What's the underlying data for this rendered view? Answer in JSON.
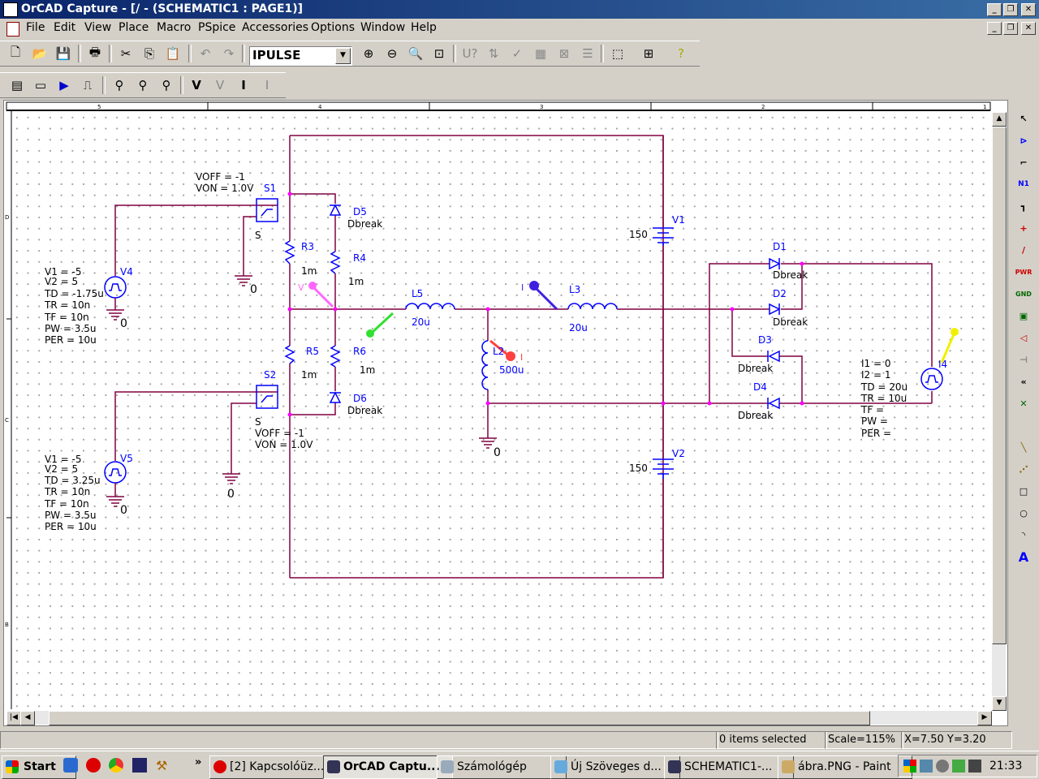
{
  "window": {
    "title": "OrCAD Capture - [/ - (SCHEMATIC1 : PAGE1)]"
  },
  "menu": [
    "File",
    "Edit",
    "View",
    "Place",
    "Macro",
    "PSpice",
    "Accessories",
    "Options",
    "Window",
    "Help"
  ],
  "toolbar": {
    "part_combo_value": "IPULSE"
  },
  "ruler": {
    "columns": [
      "5",
      "4",
      "3",
      "2",
      "1"
    ],
    "rows": [
      "D",
      "C",
      "B"
    ]
  },
  "schematic": {
    "switches": [
      {
        "ref": "S1",
        "label": "S",
        "voff": "VOFF = -1",
        "von": "VON = 1.0V"
      },
      {
        "ref": "S2",
        "label": "S",
        "voff": "VOFF = -1",
        "von": "VON = 1.0V"
      }
    ],
    "diodes": [
      {
        "ref": "D5",
        "model": "Dbreak"
      },
      {
        "ref": "D6",
        "model": "Dbreak"
      },
      {
        "ref": "D1",
        "model": "Dbreak"
      },
      {
        "ref": "D2",
        "model": "Dbreak"
      },
      {
        "ref": "D3",
        "model": "Dbreak"
      },
      {
        "ref": "D4",
        "model": "Dbreak"
      }
    ],
    "resistors": [
      {
        "ref": "R3",
        "value": "1m"
      },
      {
        "ref": "R4",
        "value": "1m"
      },
      {
        "ref": "R5",
        "value": "1m"
      },
      {
        "ref": "R6",
        "value": "1m"
      }
    ],
    "inductors": [
      {
        "ref": "L5",
        "value": "20u"
      },
      {
        "ref": "L3",
        "value": "20u"
      },
      {
        "ref": "L2",
        "value": "500u"
      }
    ],
    "batteries": [
      {
        "ref": "V1",
        "value": "150"
      },
      {
        "ref": "V2",
        "value": "150"
      }
    ],
    "ground_label": "0",
    "v4": {
      "ref": "V4",
      "params": [
        "V1 = -5",
        "V2 = 5",
        "TD = -1.75u",
        "TR = 10n",
        "TF = 10n",
        "PW = 3.5u",
        "PER = 10u"
      ]
    },
    "v5": {
      "ref": "V5",
      "params": [
        "V1 = -5",
        "V2 = 5",
        "TD = 3.25u",
        "TR = 10n",
        "TF = 10n",
        "PW = 3.5u",
        "PER = 10u"
      ]
    },
    "i4": {
      "ref": "I4",
      "params": [
        "I1 = 0",
        "I2 = 1",
        "TD = 20u",
        "TR = 10u",
        "TF =",
        "PW =",
        "PER ="
      ]
    },
    "probes": [
      {
        "label": "V",
        "color": "#ff66ff"
      },
      {
        "label": "I",
        "color": "#4020e0"
      },
      {
        "label": "I",
        "color": "#ff4040"
      },
      {
        "label": "",
        "color": "#30e030"
      },
      {
        "label": "",
        "color": "#f0f000"
      }
    ]
  },
  "status": {
    "items_selected": "0 items selected",
    "scale": "Scale=115%",
    "coords": "X=7.50  Y=3.20"
  },
  "taskbar": {
    "start": "Start",
    "tasks": [
      "[2] Kapcsolóüz...",
      "OrCAD Captu...",
      "Számológép",
      "Új Szöveges d...",
      "SCHEMATIC1-...",
      "ábra.PNG - Paint"
    ],
    "clock": "21:33"
  },
  "colors": {
    "wire": "#800040",
    "part": "#0000ff",
    "label": "#000000",
    "title_bar": "#0a246a"
  }
}
